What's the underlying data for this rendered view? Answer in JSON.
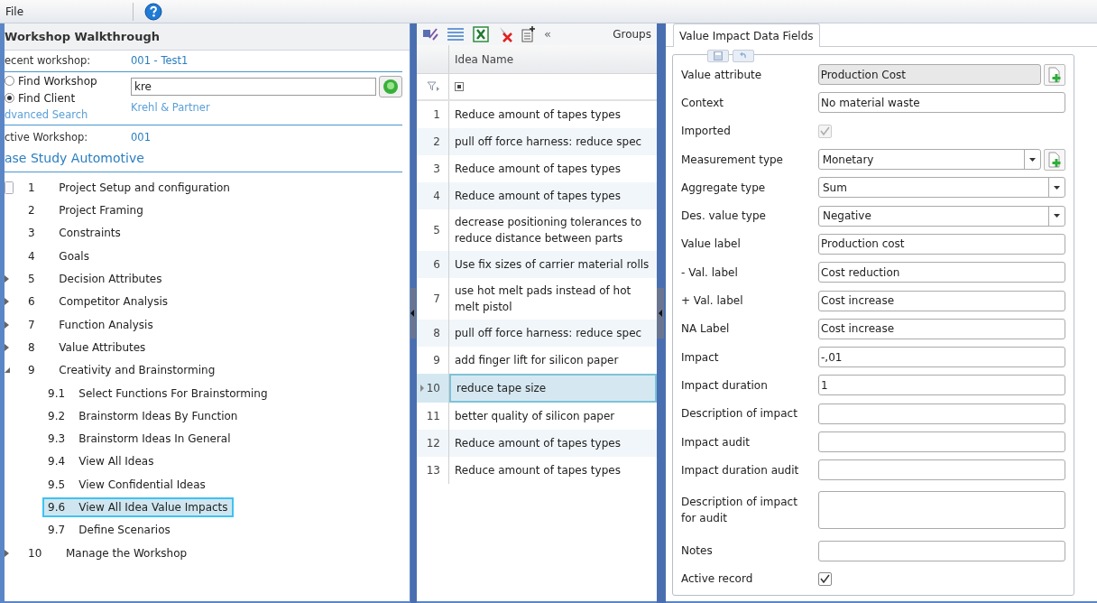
{
  "menu": {
    "items": [
      "File"
    ]
  },
  "walkthrough": {
    "title": "Workshop Walkthrough",
    "recent_label": "ecent workshop:",
    "recent_link": "001 - Test1",
    "search_options": [
      {
        "label": "Find Workshop",
        "selected": false
      },
      {
        "label": "Find Client",
        "selected": true
      }
    ],
    "search_value": "kre",
    "advanced_search": "dvanced Search",
    "result_link": "Krehl & Partner",
    "active_label": "ctive Workshop:",
    "active_value": "001",
    "case_title": "ase Study Automotive",
    "steps": [
      {
        "number": "1",
        "label": "Project Setup and configuration",
        "focused": true,
        "selected": false
      },
      {
        "number": "2",
        "label": "Project Framing",
        "expandable": false,
        "selected": false
      },
      {
        "number": "3",
        "label": "Constraints",
        "expandable": false,
        "selected": false
      },
      {
        "number": "4",
        "label": "Goals",
        "expandable": false,
        "selected": false
      },
      {
        "number": "5",
        "label": "Decision Attributes",
        "expandable": true,
        "expanded": false,
        "selected": false
      },
      {
        "number": "6",
        "label": "Competitor Analysis",
        "expandable": true,
        "expanded": false,
        "selected": false
      },
      {
        "number": "7",
        "label": "Function Analysis",
        "expandable": true,
        "expanded": false,
        "selected": false
      },
      {
        "number": "8",
        "label": "Value Attributes",
        "expandable": true,
        "expanded": false,
        "selected": false
      },
      {
        "number": "9",
        "label": "Creativity and Brainstorming",
        "expandable": true,
        "expanded": true,
        "selected": false,
        "children": [
          {
            "number": "9.1",
            "label": "Select Functions For Brainstorming",
            "selected": false
          },
          {
            "number": "9.2",
            "label": "Brainstorm Ideas By Function",
            "selected": false
          },
          {
            "number": "9.3",
            "label": "Brainstorm Ideas In General",
            "selected": false
          },
          {
            "number": "9.4",
            "label": "View All Ideas",
            "selected": false
          },
          {
            "number": "9.5",
            "label": "View Confidential Ideas",
            "selected": false
          },
          {
            "number": "9.6",
            "label": "View All Idea Value Impacts",
            "selected": true
          },
          {
            "number": "9.7",
            "label": "Define Scenarios",
            "selected": false
          }
        ]
      },
      {
        "number": "10",
        "label": "Manage the Workshop",
        "expandable": true,
        "expanded": false,
        "selected": false
      }
    ]
  },
  "ideas": {
    "toolbar_collapse": "«",
    "groups_label": "Groups",
    "column": "Idea Name",
    "rows": [
      {
        "number": "1",
        "name": "Reduce amount of tapes types",
        "selected": false
      },
      {
        "number": "2",
        "name": "pull off force harness: reduce spec",
        "selected": false
      },
      {
        "number": "3",
        "name": "Reduce amount of tapes types",
        "selected": false
      },
      {
        "number": "4",
        "name": "Reduce amount of tapes types",
        "selected": false
      },
      {
        "number": "5",
        "name": "decrease positioning tolerances to reduce distance between parts",
        "selected": false
      },
      {
        "number": "6",
        "name": "Use fix sizes of carrier material rolls",
        "selected": false
      },
      {
        "number": "7",
        "name": "use hot melt pads instead of hot melt pistol",
        "selected": false
      },
      {
        "number": "8",
        "name": "pull off force harness: reduce spec",
        "selected": false
      },
      {
        "number": "9",
        "name": "add finger lift for silicon paper",
        "selected": false
      },
      {
        "number": "10",
        "name": "reduce tape size",
        "selected": true
      },
      {
        "number": "11",
        "name": "better quality of silicon paper",
        "selected": false
      },
      {
        "number": "12",
        "name": "Reduce amount of tapes types",
        "selected": false
      },
      {
        "number": "13",
        "name": "Reduce amount of tapes types",
        "selected": false
      }
    ]
  },
  "details": {
    "tab": "Value Impact Data Fields",
    "fields": [
      {
        "kind": "readonly",
        "label": "Value attribute",
        "value": "Production Cost",
        "add_button": true
      },
      {
        "kind": "text",
        "label": "Context",
        "value": "No material waste"
      },
      {
        "kind": "checkbox",
        "label": "Imported",
        "checked": true,
        "disabled": true
      },
      {
        "kind": "dropdown",
        "label": "Measurement type",
        "value": "Monetary",
        "add_button": true
      },
      {
        "kind": "dropdown",
        "label": "Aggregate type",
        "value": "Sum",
        "add_button": false
      },
      {
        "kind": "dropdown",
        "label": "Des. value type",
        "value": "Negative",
        "add_button": false
      },
      {
        "kind": "text",
        "label": "Value label",
        "value": "Production cost"
      },
      {
        "kind": "text",
        "label": "- Val. label",
        "value": "Cost reduction"
      },
      {
        "kind": "text",
        "label": "+ Val. label",
        "value": "Cost increase"
      },
      {
        "kind": "text",
        "label": "NA Label",
        "value": "Cost increase"
      },
      {
        "kind": "text",
        "label": "Impact",
        "value": "-,01"
      },
      {
        "kind": "text",
        "label": "Impact duration",
        "value": "1"
      },
      {
        "kind": "text",
        "label": "Description of impact"
      },
      {
        "kind": "text",
        "label": "Impact audit"
      },
      {
        "kind": "text",
        "label": "Impact duration audit"
      },
      {
        "kind": "textarea",
        "label": "Description of impact for audit"
      },
      {
        "kind": "text",
        "label": "Notes"
      },
      {
        "kind": "checkbox",
        "label": "Active record",
        "checked": true,
        "disabled": false
      }
    ]
  }
}
